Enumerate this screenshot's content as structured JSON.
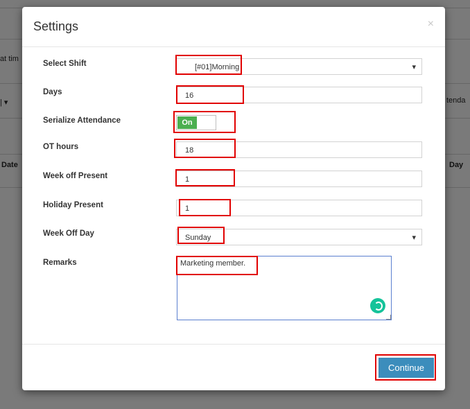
{
  "background": {
    "left_snippets": [
      "at tim",
      "| ▾",
      "Date"
    ],
    "right_snippets": [
      "tenda",
      "Day"
    ]
  },
  "modal": {
    "title": "Settings",
    "close_glyph": "×",
    "fields": {
      "select_shift": {
        "label": "Select Shift",
        "value": "[#01]Morning"
      },
      "days": {
        "label": "Days",
        "value": "16"
      },
      "serialize_attendance": {
        "label": "Serialize Attendance",
        "toggle_text": "On"
      },
      "ot_hours": {
        "label": "OT hours",
        "value": "18"
      },
      "week_off_present": {
        "label": "Week off Present",
        "value": "1"
      },
      "holiday_present": {
        "label": "Holiday Present",
        "value": "1"
      },
      "week_off_day": {
        "label": "Week Off Day",
        "value": "Sunday"
      },
      "remarks": {
        "label": "Remarks",
        "value": "Marketing member."
      }
    },
    "continue_label": "Continue"
  },
  "colors": {
    "highlight": "#e10000",
    "primary_button": "#3c8dbc",
    "toggle_on": "#4caf50"
  }
}
